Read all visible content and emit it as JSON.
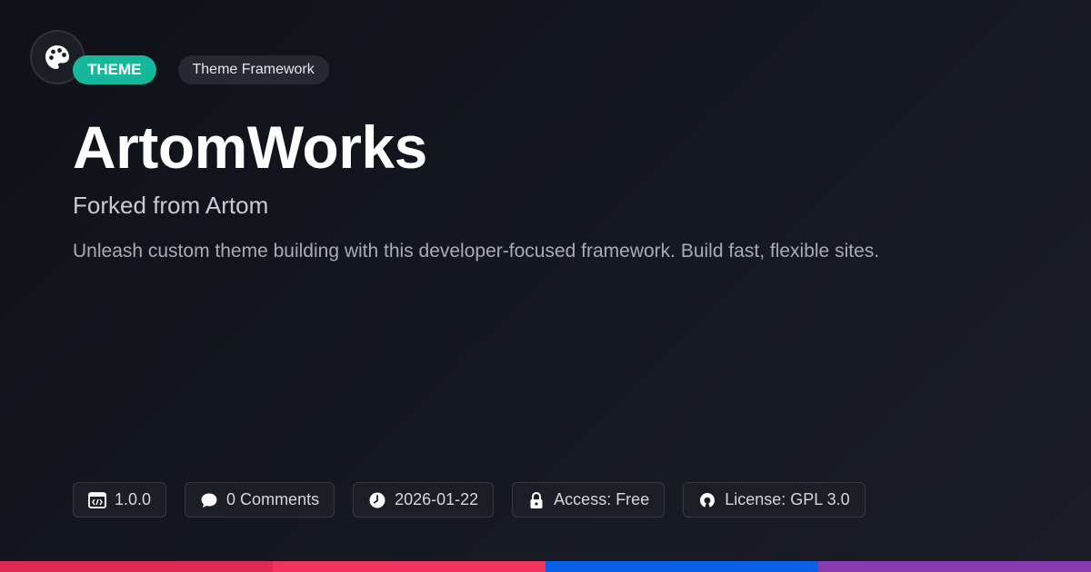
{
  "header": {
    "type_badge": "THEME",
    "category_badge": "Theme Framework"
  },
  "title": "ArtomWorks",
  "subtitle": "Forked from Artom",
  "description": "Unleash custom theme building with this developer-focused framework. Build fast, flexible sites.",
  "meta": {
    "version": "1.0.0",
    "comments": "0 Comments",
    "date": "2026-01-22",
    "access": "Access: Free",
    "license": "License: GPL 3.0"
  },
  "icons": {
    "logo": "palette-icon",
    "version": "code-icon",
    "comments": "comment-icon",
    "date": "clock-icon",
    "access": "lock-icon",
    "license": "open-source-icon"
  },
  "colors": {
    "background": "#13161d",
    "accent": "#16b89c",
    "bar_1": "#e02a55",
    "bar_2": "#f5335f",
    "bar_3": "#0a5fe8",
    "bar_4": "#8a3bb0"
  }
}
